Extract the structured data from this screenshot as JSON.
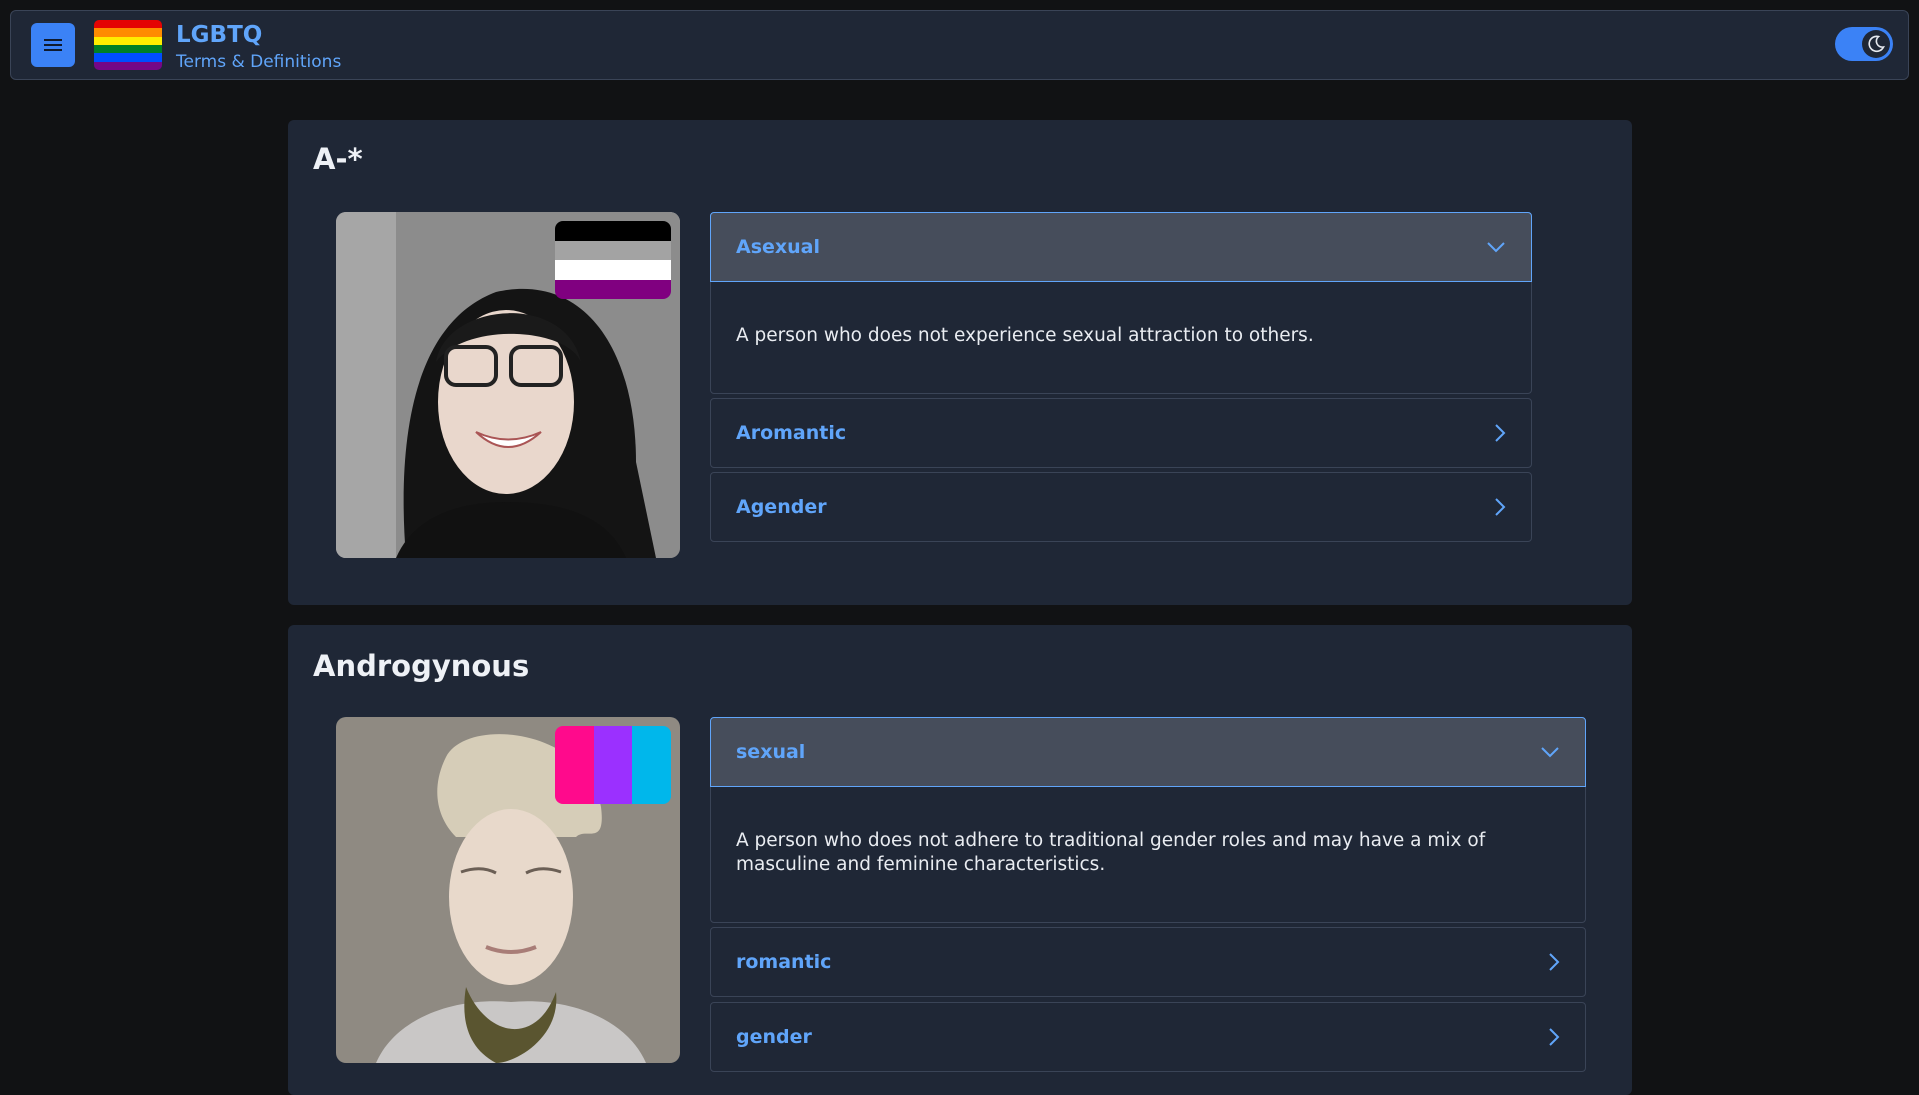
{
  "header": {
    "title": "LGBTQ",
    "subtitle": "Terms & Definitions",
    "menu_icon": "hamburger-menu-icon",
    "theme_icon": "moon-icon",
    "logo_flag_colors": [
      "#e40303",
      "#ff8c00",
      "#ffed00",
      "#008026",
      "#004dff",
      "#750787"
    ]
  },
  "sections": [
    {
      "title": "A-*",
      "photo_flag_colors": [
        "#000000",
        "#a3a3a3",
        "#ffffff",
        "#800080"
      ],
      "items": [
        {
          "label": "Asexual",
          "expanded": true,
          "definition": "A person who does not experience sexual attraction to others."
        },
        {
          "label": "Aromantic",
          "expanded": false
        },
        {
          "label": "Agender",
          "expanded": false
        }
      ]
    },
    {
      "title": "Androgynous",
      "photo_flag_colors": [
        "#ff0a8c",
        "#9b30ff",
        "#00b7eb"
      ],
      "items": [
        {
          "label": "sexual",
          "expanded": true,
          "definition": "A person who does not adhere to traditional gender roles and may have a mix of masculine and feminine characteristics."
        },
        {
          "label": "romantic",
          "expanded": false
        },
        {
          "label": "gender",
          "expanded": false
        }
      ]
    }
  ],
  "colors": {
    "accent": "#60a5fa",
    "button": "#3b82f6",
    "card": "#1f2736",
    "page": "#111214"
  }
}
